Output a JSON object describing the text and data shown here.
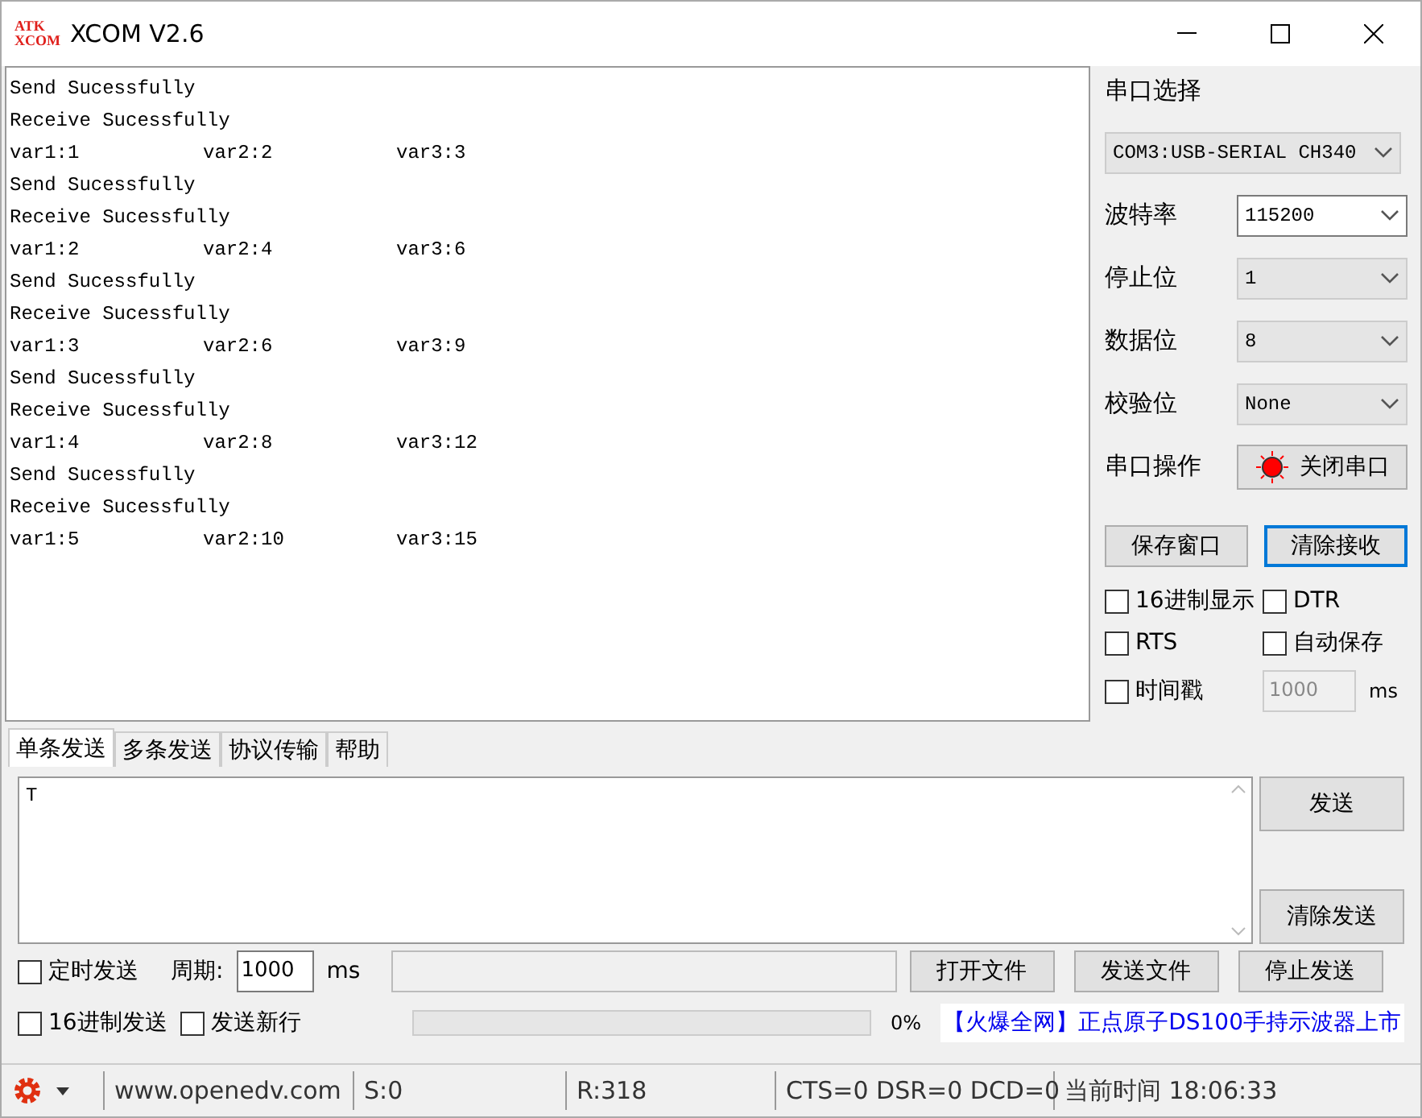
{
  "window": {
    "title": "XCOM V2.6",
    "logo": [
      "ATK",
      "XCOM"
    ]
  },
  "receive": {
    "lines": [
      [
        "Send Sucessfully"
      ],
      [
        "Receive Sucessfully"
      ],
      [
        "var1:1",
        "var2:2",
        "var3:3"
      ],
      [
        "Send Sucessfully"
      ],
      [
        "Receive Sucessfully"
      ],
      [
        "var1:2",
        "var2:4",
        "var3:6"
      ],
      [
        "Send Sucessfully"
      ],
      [
        "Receive Sucessfully"
      ],
      [
        "var1:3",
        "var2:6",
        "var3:9"
      ],
      [
        "Send Sucessfully"
      ],
      [
        "Receive Sucessfully"
      ],
      [
        "var1:4",
        "var2:8",
        "var3:12"
      ],
      [
        "Send Sucessfully"
      ],
      [
        "Receive Sucessfully"
      ],
      [
        "var1:5",
        "var2:10",
        "var3:15"
      ]
    ]
  },
  "panel": {
    "port_label": "串口选择",
    "port": "COM3:USB-SERIAL CH340",
    "settings": [
      {
        "label": "波特率",
        "value": "115200",
        "editable": true
      },
      {
        "label": "停止位",
        "value": "1",
        "editable": false
      },
      {
        "label": "数据位",
        "value": "8",
        "editable": false
      },
      {
        "label": "校验位",
        "value": "None",
        "editable": false
      }
    ],
    "operation_label": "串口操作",
    "operation_button": {
      "label": "关闭串口",
      "open": true
    },
    "buttons": [
      {
        "label": "保存窗口",
        "focused": false
      },
      {
        "label": "清除接收",
        "focused": true
      }
    ],
    "checkboxes": [
      {
        "label": "16进制显示",
        "checked": false
      },
      {
        "label": "DTR",
        "checked": false
      },
      {
        "label": "RTS",
        "checked": false
      },
      {
        "label": "自动保存",
        "checked": false
      },
      {
        "label": "时间戳",
        "checked": false
      }
    ],
    "timestamp_interval": {
      "value": "1000",
      "unit": "ms",
      "disabled": true
    }
  },
  "tabs": [
    {
      "label": "单条发送",
      "selected": true
    },
    {
      "label": "多条发送",
      "selected": false
    },
    {
      "label": "协议传输",
      "selected": false
    },
    {
      "label": "帮助",
      "selected": false
    }
  ],
  "send": {
    "text": "T",
    "send_button": "发送",
    "clear_button": "清除发送",
    "timed_send": {
      "label": "定时发送",
      "checked": false
    },
    "period_label": "周期:",
    "period": "1000",
    "period_unit": "ms",
    "file_buttons": [
      "打开文件",
      "发送文件",
      "停止发送"
    ],
    "hex_send": {
      "label": "16进制发送",
      "checked": false
    },
    "newline": {
      "label": "发送新行",
      "checked": false
    },
    "progress": {
      "level": 0,
      "reading": "0%"
    },
    "ad": "【火爆全网】正点原子DS100手持示波器上市"
  },
  "status_bar": {
    "website": "www.openedv.com",
    "sent": "S:0",
    "received": "R:318",
    "lines": "CTS=0 DSR=0 DCD=0",
    "time": "当前时间 18:06:33"
  }
}
